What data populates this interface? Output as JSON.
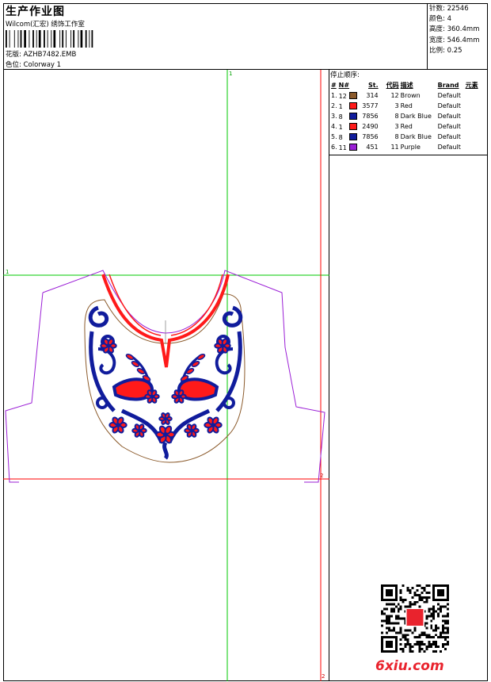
{
  "header": {
    "title": "生产作业图",
    "subtitle": "Wilcom(汇宏) 绣饰工作室",
    "pattern_label": "花版:",
    "pattern_value": "AZHB7482.EMB",
    "colorway_label": "色位:",
    "colorway_value": "Colorway 1"
  },
  "specs": [
    {
      "label": "针数:",
      "value": "22546"
    },
    {
      "label": "颜色:",
      "value": "4"
    },
    {
      "label": "高度:",
      "value": "360.4mm"
    },
    {
      "label": "宽度:",
      "value": "546.4mm"
    },
    {
      "label": "比例:",
      "value": "0.25"
    }
  ],
  "stop_sequence": {
    "title": "停止顺序:",
    "columns": [
      "#",
      "N#",
      "St.",
      "代码",
      "描述",
      "Brand",
      "元素"
    ],
    "rows": [
      {
        "idx": "1.",
        "n": "12",
        "color": "#8b5a2b",
        "st": "314",
        "code": "12",
        "desc": "Brown",
        "brand": "Default"
      },
      {
        "idx": "2.",
        "n": "1",
        "color": "#ff1a1a",
        "st": "3577",
        "code": "3",
        "desc": "Red",
        "brand": "Default"
      },
      {
        "idx": "3.",
        "n": "8",
        "color": "#101c9c",
        "st": "7856",
        "code": "8",
        "desc": "Dark Blue",
        "brand": "Default"
      },
      {
        "idx": "4.",
        "n": "1",
        "color": "#ff1a1a",
        "st": "2490",
        "code": "3",
        "desc": "Red",
        "brand": "Default"
      },
      {
        "idx": "5.",
        "n": "8",
        "color": "#101c9c",
        "st": "7856",
        "code": "8",
        "desc": "Dark Blue",
        "brand": "Default"
      },
      {
        "idx": "6.",
        "n": "11",
        "color": "#9b1fd6",
        "st": "451",
        "code": "11",
        "desc": "Purple",
        "brand": "Default"
      }
    ]
  },
  "canvas": {
    "marker_top": "1",
    "marker_left": "1",
    "marker_right": "2",
    "marker_bottom": "2"
  },
  "colors": {
    "guide_green": "#00c800",
    "guide_red": "#ff0000",
    "outline_purple": "#9b1fd6",
    "embroidery_blue": "#101c9c",
    "embroidery_red": "#ff1a1a",
    "hoop_brown": "#8b5a2b"
  },
  "watermark": {
    "brand": "6xiu.com"
  }
}
